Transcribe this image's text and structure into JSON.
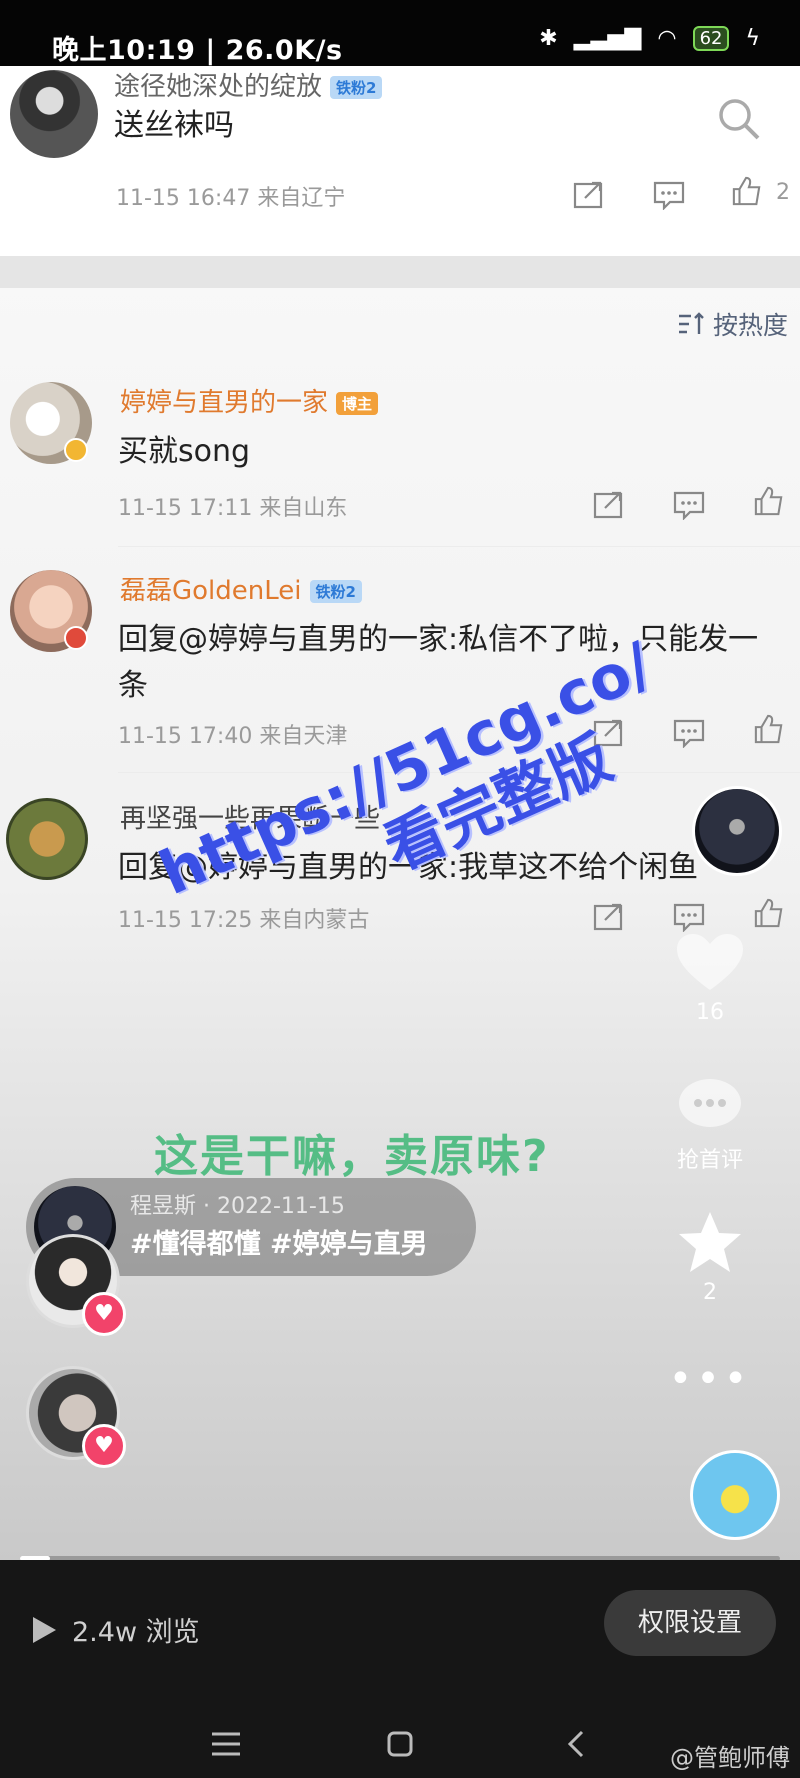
{
  "status_bar": {
    "time": "晚上10:19 | 26.0K/s",
    "battery": "62"
  },
  "top_comment": {
    "name": "途径她深处的绽放",
    "badge": "铁粉2",
    "text": "送丝袜吗",
    "meta": "11-15 16:47 来自辽宁",
    "like_count": "2"
  },
  "sort_label": "按热度",
  "comments": [
    {
      "name": "婷婷与直男的一家",
      "badge": "博主",
      "text": "买就song",
      "meta": "11-15 17:11 来自山东"
    },
    {
      "name": "磊磊GoldenLei",
      "badge": "铁粉2",
      "text_line1": "回复@婷婷与直男的一家:私信不了啦，只能发一",
      "text_line2": "条",
      "meta": "11-15 17:40 来自天津"
    },
    {
      "name": "再坚强一些再果断一些",
      "text": "回复@婷婷与直男的一家:我草这不给个闲鱼",
      "meta": "11-15 17:25 来自内蒙古"
    }
  ],
  "watermark": {
    "line1": "https://51cg.co/",
    "line2": "看完整版"
  },
  "overlay_caption": "这是干嘛，卖原味?",
  "side_actions": {
    "likes": "16",
    "comment_label": "抢首评",
    "favorites": "2"
  },
  "post": {
    "author_date": "程昱斯 · 2022-11-15",
    "tags": "#懂得都懂 #婷婷与直男"
  },
  "progress": 0.04,
  "footer": {
    "views": "2.4w 浏览",
    "permission_button": "权限设置",
    "weibo_credit": "@管鲍师傅"
  },
  "colors": {
    "username": "#e07a2e",
    "mention": "#4f7fc1",
    "caption": "#55bd85",
    "watermark": "#3a50e6",
    "heart": "#f2436a"
  },
  "icons": [
    "search-icon",
    "share-icon",
    "comment-icon",
    "like-icon",
    "sort-icon",
    "heart-icon",
    "star-icon",
    "more-icon",
    "play-icon",
    "menu-icon",
    "home-icon",
    "back-icon"
  ]
}
